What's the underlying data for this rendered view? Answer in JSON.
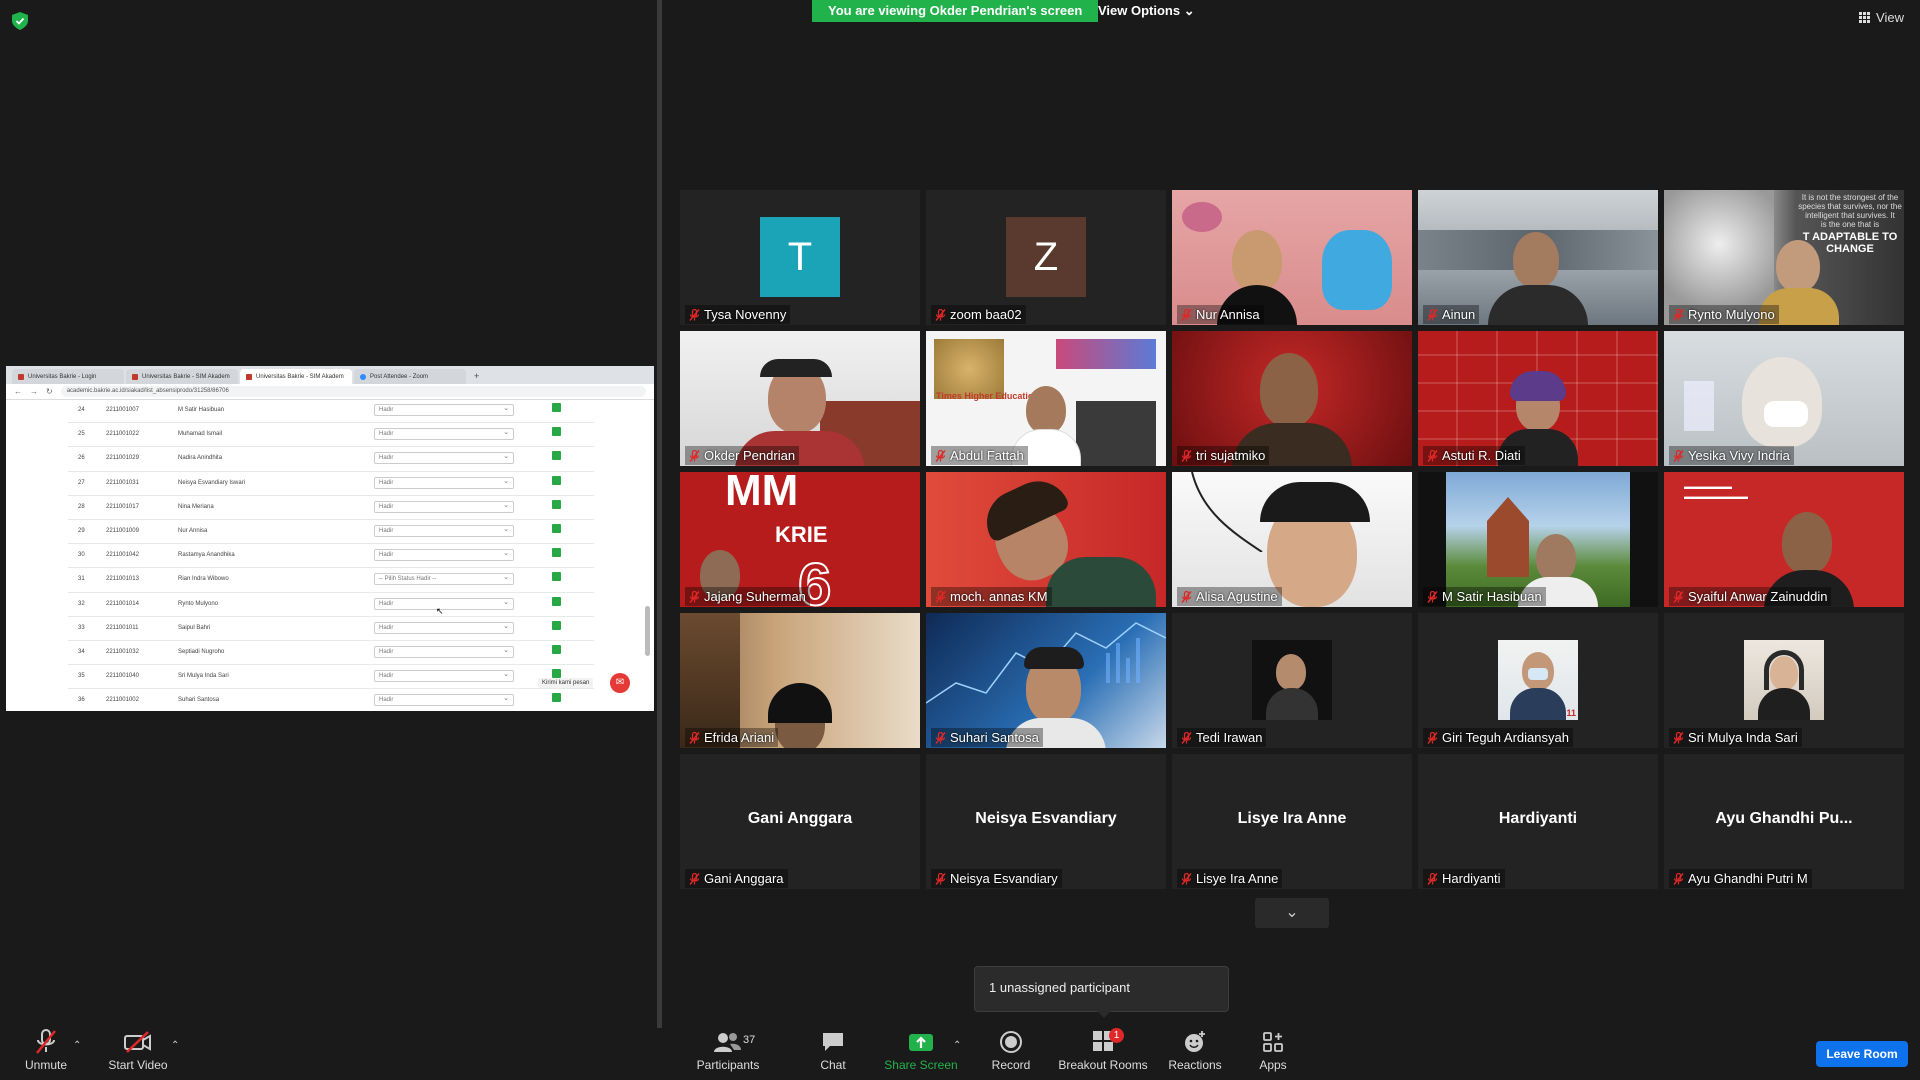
{
  "banner": {
    "viewing_text": "You are viewing Okder Pendrian's screen",
    "view_options_label": "View Options ⌄"
  },
  "top_right": {
    "view_label": "View"
  },
  "share": {
    "tabs": [
      {
        "label": "Universitas Bakrie - Login",
        "active": false
      },
      {
        "label": "Universitas Bakrie - SIM Akadem",
        "active": false
      },
      {
        "label": "Universitas Bakrie - SIM Akadem",
        "active": true
      },
      {
        "label": "Post Attendee - Zoom",
        "active": false
      }
    ],
    "url": "academic.bakrie.ac.id/siakad/list_absensiprodo/31258/86706",
    "rows": [
      {
        "no": "24",
        "nim": "2211001007",
        "nama": "M Satir Hasibuan",
        "status": "Hadir"
      },
      {
        "no": "25",
        "nim": "2211001022",
        "nama": "Muhamad Ismail",
        "status": "Hadir"
      },
      {
        "no": "26",
        "nim": "2211001029",
        "nama": "Nadira Anindhita",
        "status": "Hadir"
      },
      {
        "no": "27",
        "nim": "2211001031",
        "nama": "Neisya Esvandiary Iswari",
        "status": "Hadir"
      },
      {
        "no": "28",
        "nim": "2211001017",
        "nama": "Nina Meriana",
        "status": "Hadir"
      },
      {
        "no": "29",
        "nim": "2211001009",
        "nama": "Nur Annisa",
        "status": "Hadir"
      },
      {
        "no": "30",
        "nim": "2211001042",
        "nama": "Rastamya Anandhika",
        "status": "Hadir"
      },
      {
        "no": "31",
        "nim": "2211001013",
        "nama": "Rian Indra Wibowo",
        "status": "-- Pilih Status Hadir --"
      },
      {
        "no": "32",
        "nim": "2211001014",
        "nama": "Rynto Mulyono",
        "status": "Hadir"
      },
      {
        "no": "33",
        "nim": "2211001011",
        "nama": "Saipul Bahri",
        "status": "Hadir"
      },
      {
        "no": "34",
        "nim": "2211001032",
        "nama": "Septiadi Nugroho",
        "status": "Hadir"
      },
      {
        "no": "35",
        "nim": "2211001040",
        "nama": "Sri Mulya Inda Sari",
        "status": "Hadir"
      },
      {
        "no": "36",
        "nim": "2211001002",
        "nama": "Suhari Santosa",
        "status": "Hadir"
      }
    ],
    "chat_tip": "Kirimi kami pesan"
  },
  "participants": [
    {
      "name": "Tysa Novenny",
      "initial": "T",
      "avatar_color": "#1ba3b8"
    },
    {
      "name": "zoom baa02",
      "initial": "Z",
      "avatar_color": "#5a3a2e"
    },
    {
      "name": "Nur Annisa"
    },
    {
      "name": "Ainun"
    },
    {
      "name": "Rynto Mulyono",
      "bg_text": [
        "It is not the strongest of the",
        "species that survives, nor the",
        "intelligent that survives. It",
        "is the one that is",
        "T ADAPTABLE TO",
        "CHANGE"
      ]
    },
    {
      "name": "Okder Pendrian"
    },
    {
      "name": "Abdul Fattah",
      "bg_text": [
        "Times Higher Education"
      ]
    },
    {
      "name": "tri sujatmiko"
    },
    {
      "name": "Astuti R. Diati"
    },
    {
      "name": "Yesika Vivy Indria"
    },
    {
      "name": "Jajang Suherman",
      "bg_text": [
        "MM",
        "KRIE",
        "6"
      ]
    },
    {
      "name": "moch. annas KM"
    },
    {
      "name": "Alisa Agustine"
    },
    {
      "name": "M Satir Hasibuan"
    },
    {
      "name": "Syaiful Anwar Zainuddin"
    },
    {
      "name": "Efrida Ariani"
    },
    {
      "name": "Suhari Santosa"
    },
    {
      "name": "Tedi Irawan"
    },
    {
      "name": "Giri Teguh Ardiansyah"
    },
    {
      "name": "Sri Mulya Inda Sari"
    },
    {
      "name": "Gani Anggara",
      "display": "Gani Anggara"
    },
    {
      "name": "Neisya Esvandiary",
      "display": "Neisya Esvandiary"
    },
    {
      "name": "Lisye Ira Anne",
      "display": "Lisye Ira Anne"
    },
    {
      "name": "Hardiyanti",
      "display": "Hardiyanti"
    },
    {
      "name": "Ayu Ghandhi Putri M",
      "display": "Ayu Ghandhi Pu..."
    }
  ],
  "unassigned": "1 unassigned participant",
  "toolbar": {
    "unmute": "Unmute",
    "start_video": "Start Video",
    "participants": "Participants",
    "participants_count": "37",
    "chat": "Chat",
    "share_screen": "Share Screen",
    "record": "Record",
    "breakout_rooms": "Breakout Rooms",
    "breakout_badge": "1",
    "reactions": "Reactions",
    "apps": "Apps",
    "leave": "Leave Room"
  },
  "colors": {
    "banner_green": "#22b24c",
    "share_green": "#22b24c",
    "leave_blue": "#0e72ed",
    "active_speaker": "#e9e94a",
    "muted_red": "#e02828"
  }
}
